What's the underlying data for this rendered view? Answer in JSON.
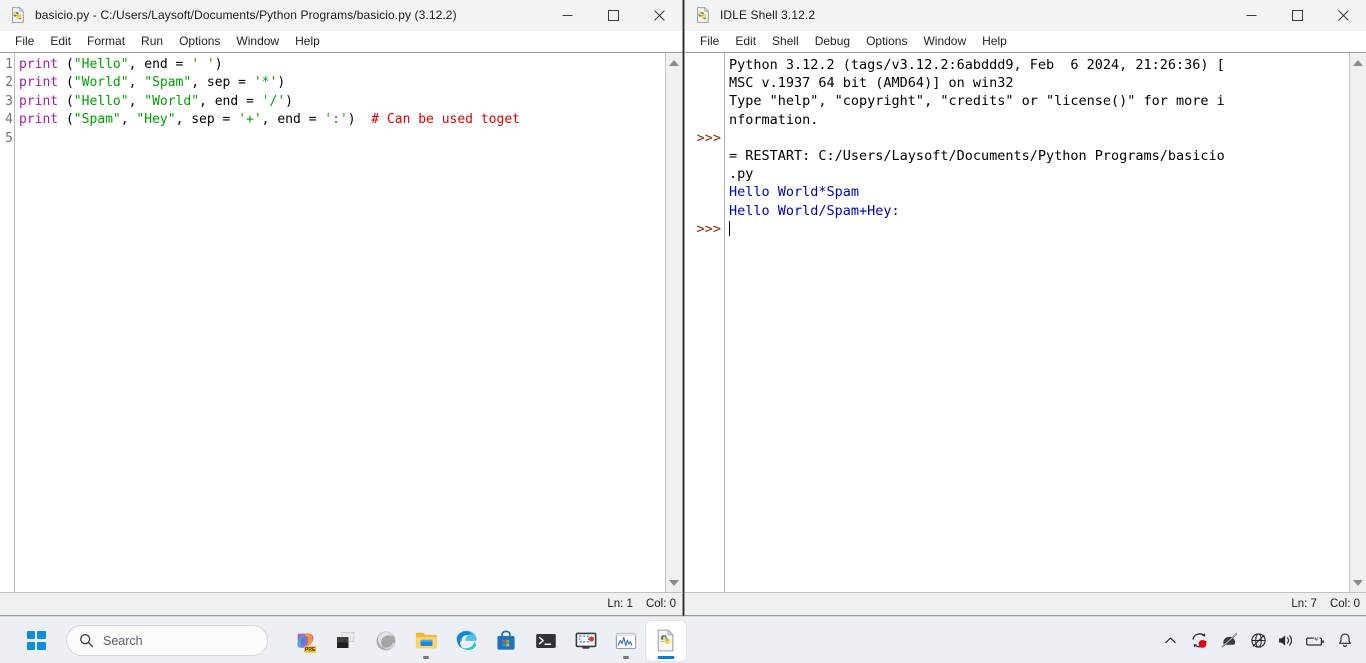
{
  "desktop": {
    "background_color": "#2b2b2b"
  },
  "editor_window": {
    "icon": "python-file-icon",
    "title": "basicio.py - C:/Users/Laysoft/Documents/Python Programs/basicio.py (3.12.2)",
    "controls": {
      "minimize": "—",
      "maximize": "☐",
      "close": "✕"
    },
    "menu": [
      "File",
      "Edit",
      "Format",
      "Run",
      "Options",
      "Window",
      "Help"
    ],
    "line_numbers": [
      "1",
      "2",
      "3",
      "4",
      "5"
    ],
    "code_lines": [
      [
        {
          "t": "print",
          "c": "kw-builtin"
        },
        {
          "t": " (",
          "c": "kw-plain"
        },
        {
          "t": "\"Hello\"",
          "c": "kw-string"
        },
        {
          "t": ", end = ",
          "c": "kw-plain"
        },
        {
          "t": "' '",
          "c": "kw-string"
        },
        {
          "t": ")",
          "c": "kw-plain"
        }
      ],
      [
        {
          "t": "print",
          "c": "kw-builtin"
        },
        {
          "t": " (",
          "c": "kw-plain"
        },
        {
          "t": "\"World\"",
          "c": "kw-string"
        },
        {
          "t": ", ",
          "c": "kw-plain"
        },
        {
          "t": "\"Spam\"",
          "c": "kw-string"
        },
        {
          "t": ", sep = ",
          "c": "kw-plain"
        },
        {
          "t": "'*'",
          "c": "kw-string"
        },
        {
          "t": ")",
          "c": "kw-plain"
        }
      ],
      [
        {
          "t": "print",
          "c": "kw-builtin"
        },
        {
          "t": " (",
          "c": "kw-plain"
        },
        {
          "t": "\"Hello\"",
          "c": "kw-string"
        },
        {
          "t": ", ",
          "c": "kw-plain"
        },
        {
          "t": "\"World\"",
          "c": "kw-string"
        },
        {
          "t": ", end = ",
          "c": "kw-plain"
        },
        {
          "t": "'/'",
          "c": "kw-string"
        },
        {
          "t": ")",
          "c": "kw-plain"
        }
      ],
      [
        {
          "t": "print",
          "c": "kw-builtin"
        },
        {
          "t": " (",
          "c": "kw-plain"
        },
        {
          "t": "\"Spam\"",
          "c": "kw-string"
        },
        {
          "t": ", ",
          "c": "kw-plain"
        },
        {
          "t": "\"Hey\"",
          "c": "kw-string"
        },
        {
          "t": ", sep = ",
          "c": "kw-plain"
        },
        {
          "t": "'+'",
          "c": "kw-string"
        },
        {
          "t": ", end = ",
          "c": "kw-plain"
        },
        {
          "t": "':'",
          "c": "kw-string"
        },
        {
          "t": ")  ",
          "c": "kw-plain"
        },
        {
          "t": "# Can be used toget",
          "c": "kw-comment"
        }
      ],
      []
    ],
    "status": {
      "line": "Ln: 1",
      "column": "Col: 0"
    },
    "syntax_colors": {
      "builtin": "#a020a0",
      "string": "#00a000",
      "comment": "#dd0000",
      "plain": "#000000"
    }
  },
  "shell_window": {
    "icon": "python-file-icon",
    "title": "IDLE Shell 3.12.2",
    "controls": {
      "minimize": "—",
      "maximize": "☐",
      "close": "✕"
    },
    "menu": [
      "File",
      "Edit",
      "Shell",
      "Debug",
      "Options",
      "Window",
      "Help"
    ],
    "prompt_text": ">>>",
    "prompt_color": "#8b2500",
    "output_color": "#0000bb",
    "lines": [
      {
        "prompt": "",
        "segments": [
          {
            "t": "Python 3.12.2 (tags/v3.12.2:6abddd9, Feb  6 2024, 21:26:36) [",
            "c": "sh-plain"
          }
        ]
      },
      {
        "prompt": "",
        "segments": [
          {
            "t": "MSC v.1937 64 bit (AMD64)] on win32",
            "c": "sh-plain"
          }
        ]
      },
      {
        "prompt": "",
        "segments": [
          {
            "t": "Type \"help\", \"copyright\", \"credits\" or \"license()\" for more i",
            "c": "sh-plain"
          }
        ]
      },
      {
        "prompt": "",
        "segments": [
          {
            "t": "nformation.",
            "c": "sh-plain"
          }
        ]
      },
      {
        "prompt": ">>>",
        "segments": []
      },
      {
        "prompt": "",
        "segments": [
          {
            "t": "= RESTART: C:/Users/Laysoft/Documents/Python Programs/basicio",
            "c": "sh-plain"
          }
        ]
      },
      {
        "prompt": "",
        "segments": [
          {
            "t": ".py",
            "c": "sh-plain"
          }
        ]
      },
      {
        "prompt": "",
        "segments": [
          {
            "t": "Hello World*Spam",
            "c": "sh-out"
          }
        ]
      },
      {
        "prompt": "",
        "segments": [
          {
            "t": "Hello World/Spam+Hey:",
            "c": "sh-out"
          }
        ]
      },
      {
        "prompt": ">>>",
        "segments": [],
        "caret": true
      }
    ],
    "status": {
      "line": "Ln: 7",
      "column": "Col: 0"
    }
  },
  "taskbar": {
    "start": "start-button",
    "search": {
      "placeholder": "Search",
      "icon": "search-icon"
    },
    "apps": [
      {
        "name": "copilot",
        "label": "Copilot",
        "badge": "PRE",
        "active": false,
        "running": false
      },
      {
        "name": "task-view",
        "label": "Task View",
        "active": false,
        "running": false
      },
      {
        "name": "edge-dev",
        "label": "Microsoft Edge Dev",
        "active": false,
        "running": false
      },
      {
        "name": "file-explorer",
        "label": "File Explorer",
        "active": false,
        "running": true
      },
      {
        "name": "microsoft-edge",
        "label": "Microsoft Edge",
        "active": false,
        "running": false
      },
      {
        "name": "microsoft-store",
        "label": "Microsoft Store",
        "active": false,
        "running": false
      },
      {
        "name": "terminal",
        "label": "Terminal",
        "active": false,
        "running": false
      },
      {
        "name": "snipping-tool",
        "label": "Snipping Tool",
        "active": false,
        "running": false
      },
      {
        "name": "task-manager",
        "label": "Task Manager",
        "active": false,
        "running": true
      },
      {
        "name": "python-idle",
        "label": "IDLE",
        "active": true,
        "running": true
      }
    ],
    "tray": [
      {
        "name": "show-hidden-icons",
        "label": "Show hidden icons"
      },
      {
        "name": "recording-indicator",
        "label": "Recording"
      },
      {
        "name": "touchpad-disabled",
        "label": "Touchpad off"
      },
      {
        "name": "network",
        "label": "Network"
      },
      {
        "name": "volume",
        "label": "Volume"
      },
      {
        "name": "battery",
        "label": "Battery"
      },
      {
        "name": "notifications",
        "label": "Notifications"
      }
    ]
  }
}
